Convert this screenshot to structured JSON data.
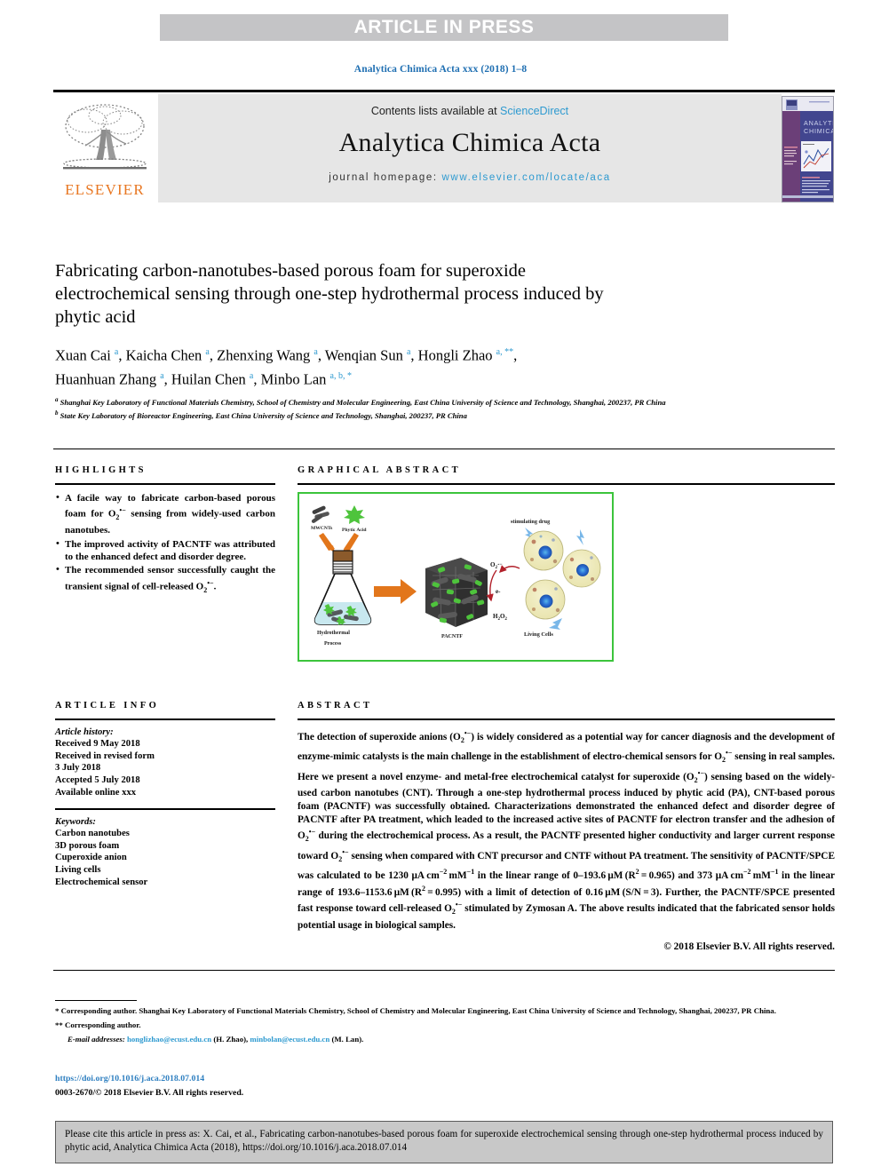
{
  "banner": {
    "text": "ARTICLE IN PRESS"
  },
  "running_head": "Analytica Chimica Acta xxx (2018) 1–8",
  "masthead": {
    "contents_prefix": "Contents lists available at ",
    "contents_link": "ScienceDirect",
    "journal_title": "Analytica Chimica Acta",
    "homepage_prefix": "journal homepage: ",
    "homepage_link": "www.elsevier.com/locate/aca",
    "publisher_logo_text": "ELSEVIER",
    "cover_title_line1": "ANALYTICA",
    "cover_title_line2": "CHIMICA ACTA"
  },
  "article": {
    "title": "Fabricating carbon-nanotubes-based porous foam for superoxide electrochemical sensing through one-step hydrothermal process induced by phytic acid",
    "authors_line1": "Xuan Cai a, Kaicha Chen a, Zhenxing Wang a, Wenqian Sun a, Hongli Zhao a, **,",
    "authors_line2": "Huanhuan Zhang a, Huilan Chen a, Minbo Lan a, b, *",
    "affiliation_a": "Shanghai Key Laboratory of Functional Materials Chemistry, School of Chemistry and Molecular Engineering, East China University of Science and Technology, Shanghai, 200237, PR China",
    "affiliation_b": "State Key Laboratory of Bioreactor Engineering, East China University of Science and Technology, Shanghai, 200237, PR China"
  },
  "sections": {
    "highlights_heading": "HIGHLIGHTS",
    "graphical_abstract_heading": "GRAPHICAL ABSTRACT",
    "article_info_heading": "ARTICLE INFO",
    "abstract_heading": "ABSTRACT"
  },
  "highlights": [
    "A facile way to fabricate carbon-based porous foam for O2•− sensing from widely-used carbon nanotubes.",
    "The improved activity of PACNTF was attributed to the enhanced defect and disorder degree.",
    "The recommended sensor successfully caught the transient signal of cell-released O2•−."
  ],
  "article_info": {
    "history_label": "Article history:",
    "history_lines": [
      "Received 9 May 2018",
      "Received in revised form",
      "3 July 2018",
      "Accepted 5 July 2018",
      "Available online xxx"
    ],
    "keywords_label": "Keywords:",
    "keywords": [
      "Carbon nanotubes",
      "3D porous foam",
      "Cuperoxide anion",
      "Living cells",
      "Electrochemical sensor"
    ]
  },
  "abstract": {
    "text": "The detection of superoxide anions (O2•−) is widely considered as a potential way for cancer diagnosis and the development of enzyme-mimic catalysts is the main challenge in the establishment of electro-chemical sensors for O2•− sensing in real samples. Here we present a novel enzyme- and metal-free electrochemical catalyst for superoxide (O2•−) sensing based on the widely-used carbon nanotubes (CNT). Through a one-step hydrothermal process induced by phytic acid (PA), CNT-based porous foam (PACNTF) was successfully obtained. Characterizations demonstrated the enhanced defect and disorder degree of PACNTF after PA treatment, which leaded to the increased active sites of PACNTF for electron transfer and the adhesion of O2•− during the electrochemical process. As a result, the PACNTF presented higher conductivity and larger current response toward O2•− sensing when compared with CNT precursor and CNTF without PA treatment. The sensitivity of PACNTF/SPCE was calculated to be 1230 μA cm−2 mM−1 in the linear range of 0–193.6 μM (R2 = 0.965) and 373 μA cm−2 mM−1 in the linear range of 193.6–1153.6 μM (R2 = 0.995) with a limit of detection of 0.16 μM (S/N = 3). Further, the PACNTF/SPCE presented fast response toward cell-released O2•− stimulated by Zymosan A. The above results indicated that the fabricated sensor holds potential usage in biological samples.",
    "copyright": "© 2018 Elsevier B.V. All rights reserved."
  },
  "graphical_abstract": {
    "label_mwcnts": "MWCNTs",
    "label_phytic_acid": "Phytic Acid",
    "label_hydrothermal_1": "Hydrothermal",
    "label_hydrothermal_2": "Process",
    "label_pacntf": "PACNTF",
    "label_o2": "O2·−",
    "label_electron": "e-",
    "label_h2o2": "H2O2",
    "label_stimulating_drug": "stimulating drug",
    "label_living_cells": "Living Cells"
  },
  "footnotes": {
    "corresponding_single_star": "* Corresponding author. Shanghai Key Laboratory of Functional Materials Chemistry, School of Chemistry and Molecular Engineering, East China University of Science and Technology, Shanghai, 200237, PR China.",
    "corresponding_double_star": "** Corresponding author.",
    "email_label": "E-mail addresses:",
    "email_1": "honglizhao@ecust.edu.cn",
    "email_1_owner": "(H. Zhao),",
    "email_2": "minbolan@ecust.edu.cn",
    "email_2_owner": "(M. Lan).",
    "doi": "https://doi.org/10.1016/j.aca.2018.07.014",
    "issn_copyright": "0003-2670/© 2018 Elsevier B.V. All rights reserved."
  },
  "cite_box": {
    "text": "Please cite this article in press as: X. Cai, et al., Fabricating carbon-nanotubes-based porous foam for superoxide electrochemical sensing through one-step hydrothermal process induced by phytic acid, Analytica Chimica Acta (2018), https://doi.org/10.1016/j.aca.2018.07.014"
  },
  "colors": {
    "link": "#2e9ad0",
    "banner_bg": "#c4c4c6",
    "masthead_bg": "#e6e6e6",
    "elsevier_orange": "#e87722",
    "ga_border": "#3cc43c",
    "cite_bg": "#c8c8c8"
  }
}
